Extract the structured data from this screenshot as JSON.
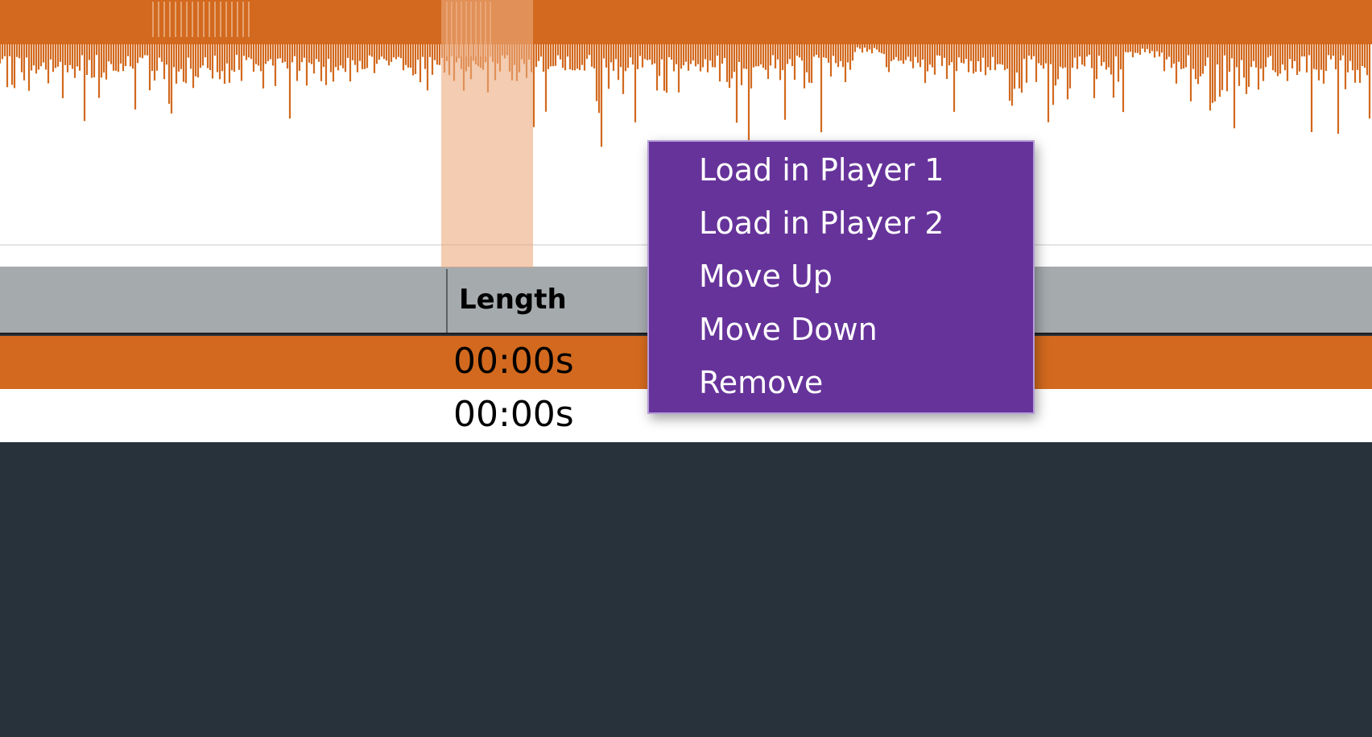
{
  "colors": {
    "waveform": "#d2691e",
    "selected_row": "#d2691e",
    "menu_background": "#66339a",
    "header_background": "#a5aaad",
    "app_background": "#28323a"
  },
  "table": {
    "columns": [
      {
        "label": "Length"
      }
    ],
    "rows": [
      {
        "length": "00:00s",
        "selected": true
      },
      {
        "length": "00:00s",
        "selected": false
      }
    ]
  },
  "context_menu": {
    "items": [
      {
        "label": "Load in Player 1"
      },
      {
        "label": "Load in Player 2"
      },
      {
        "label": "Move Up"
      },
      {
        "label": "Move Down"
      },
      {
        "label": "Remove"
      }
    ]
  }
}
